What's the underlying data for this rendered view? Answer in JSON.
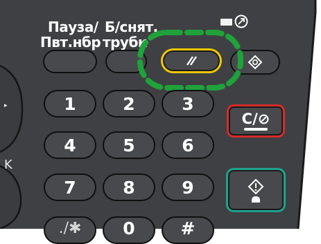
{
  "labels": {
    "pause": "Пауза/",
    "pause2": "Пвт.нбр",
    "hook": "Б/снят.",
    "hook2": "трубк"
  },
  "keypad": {
    "k1": "1",
    "k2": "2",
    "k3": "3",
    "k4": "4",
    "k5": "5",
    "k6": "6",
    "k7": "7",
    "k8": "8",
    "k9": "9",
    "k_star": "./✱",
    "k0": "0",
    "k_hash": "#"
  },
  "clear_stop": {
    "label": "C/⊘"
  },
  "edge_glyph": "K",
  "icons": {
    "reset": "reset-slash-icon",
    "start": "start-diamond-icon",
    "energy": "energy-saver-icon",
    "check": "check-status-icon"
  },
  "colors": {
    "panel": "#3f4043",
    "reset_ring": "#f0c800",
    "highlight": "#1fa23a",
    "clear_border": "#d62a2a",
    "start_border": "#1ea38c"
  }
}
